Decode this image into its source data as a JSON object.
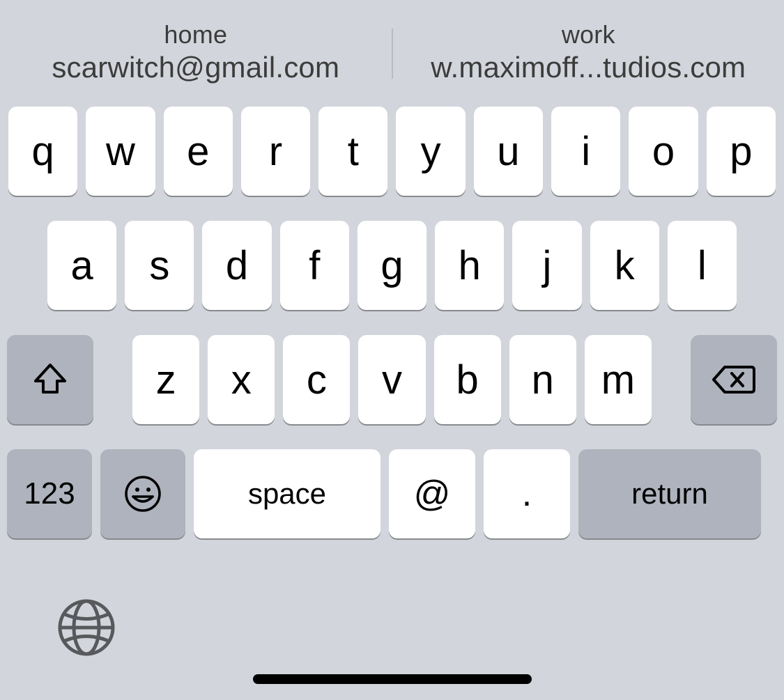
{
  "suggestions": [
    {
      "label": "home",
      "value": "scarwitch@gmail.com"
    },
    {
      "label": "work",
      "value": "w.maximoff...tudios.com"
    }
  ],
  "keyboard": {
    "row1": [
      "q",
      "w",
      "e",
      "r",
      "t",
      "y",
      "u",
      "i",
      "o",
      "p"
    ],
    "row2": [
      "a",
      "s",
      "d",
      "f",
      "g",
      "h",
      "j",
      "k",
      "l"
    ],
    "row3": [
      "z",
      "x",
      "c",
      "v",
      "b",
      "n",
      "m"
    ],
    "numbers_label": "123",
    "space_label": "space",
    "at_label": "@",
    "dot_label": ".",
    "return_label": "return"
  }
}
